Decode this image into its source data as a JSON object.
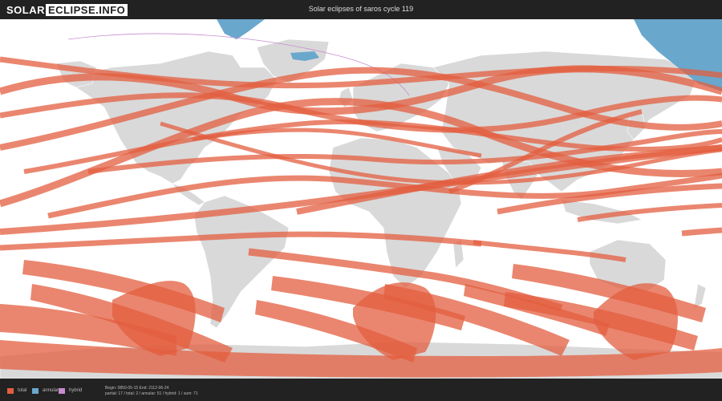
{
  "header": {
    "logo_part1": "SOLAR",
    "logo_part2": "ECLIPSE.INFO",
    "title": "Solar eclipses of saros cycle 119"
  },
  "legend": [
    {
      "label": "total",
      "color": "#e35d3f"
    },
    {
      "label": "annular",
      "color": "#6aa7cc"
    },
    {
      "label": "hybrid",
      "color": "#c98bd0"
    }
  ],
  "stats": {
    "line1": "Begin: 0850-05-15 End: 2112-06-24",
    "line2": "partial: 17 / total: 2 / annular: 51 / hybrid: 1 / sum: 71"
  },
  "colors": {
    "land": "#d9d9d9",
    "ocean": "#ffffff",
    "total": "#e35d3f",
    "annular": "#6aa7cc",
    "hybrid": "#c98bd0",
    "bar": "#222222"
  }
}
